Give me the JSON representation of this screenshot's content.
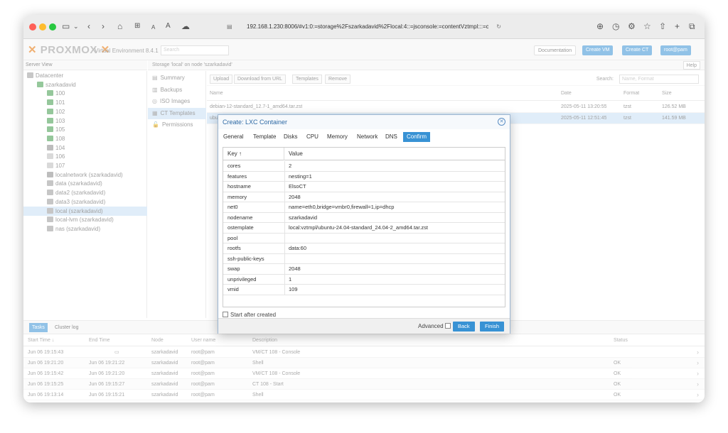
{
  "browser": {
    "url": "192.168.1.230:8006/#v1:0:=storage%2Fszarkadavid%2Flocal:4::=jsconsole:=contentVztmpl:::=con"
  },
  "header": {
    "logo": "PROXMOX",
    "version": "Virtual Environment 8.4.1",
    "search_placeholder": "Search",
    "buttons": {
      "documentation": "Documentation",
      "create_vm": "Create VM",
      "create_ct": "Create CT",
      "user": "root@pam"
    }
  },
  "server_view": "Server View",
  "tree": [
    {
      "label": "Datacenter",
      "icon": "datacenter-icon",
      "indent": 0
    },
    {
      "label": "szarkadavid",
      "icon": "node-icon",
      "indent": 1
    },
    {
      "label": "100",
      "icon": "container-icon",
      "indent": 2
    },
    {
      "label": "101",
      "icon": "container-icon",
      "indent": 2
    },
    {
      "label": "102",
      "icon": "container-icon",
      "indent": 2
    },
    {
      "label": "103",
      "icon": "container-icon",
      "indent": 2
    },
    {
      "label": "105",
      "icon": "container-icon",
      "indent": 2
    },
    {
      "label": "108",
      "icon": "container-icon",
      "indent": 2
    },
    {
      "label": "104",
      "icon": "vm-icon",
      "indent": 2
    },
    {
      "label": "106",
      "icon": "stopped-container-icon",
      "indent": 2
    },
    {
      "label": "107",
      "icon": "stopped-container-icon",
      "indent": 2
    },
    {
      "label": "localnetwork (szarkadavid)",
      "icon": "network-icon",
      "indent": 2
    },
    {
      "label": "data (szarkadavid)",
      "icon": "storage-icon",
      "indent": 2
    },
    {
      "label": "data2 (szarkadavid)",
      "icon": "storage-icon",
      "indent": 2
    },
    {
      "label": "data3 (szarkadavid)",
      "icon": "storage-icon",
      "indent": 2
    },
    {
      "label": "local (szarkadavid)",
      "icon": "storage-icon",
      "indent": 2
    },
    {
      "label": "local-lvm (szarkadavid)",
      "icon": "storage-icon",
      "indent": 2
    },
    {
      "label": "nas (szarkadavid)",
      "icon": "storage-icon",
      "indent": 2
    }
  ],
  "storage": {
    "title": "Storage 'local' on node 'szarkadavid'",
    "help": "Help",
    "nav": [
      {
        "label": "Summary",
        "icon": "summary-icon"
      },
      {
        "label": "Backups",
        "icon": "backups-icon"
      },
      {
        "label": "ISO Images",
        "icon": "iso-icon"
      },
      {
        "label": "CT Templates",
        "icon": "templates-icon"
      },
      {
        "label": "Permissions",
        "icon": "permissions-icon"
      }
    ],
    "toolbar": {
      "upload": "Upload",
      "download": "Download from URL",
      "templates": "Templates",
      "remove": "Remove",
      "search_label": "Search:",
      "search_placeholder": "Name, Format"
    },
    "columns": {
      "name": "Name",
      "date": "Date",
      "format": "Format",
      "size": "Size"
    },
    "rows": [
      {
        "name": "debian-12-standard_12.7-1_amd64.tar.zst",
        "date": "2025-05-11 13:20:55",
        "format": "tzst",
        "size": "126.52 MB"
      },
      {
        "name": "ubuntu-24.04-standard_24.04-2_amd64.tar.zst",
        "date": "2025-05-11 12:51:45",
        "format": "tzst",
        "size": "141.59 MB"
      }
    ]
  },
  "tasks": {
    "tabs": {
      "tasks": "Tasks",
      "cluster_log": "Cluster log"
    },
    "columns": {
      "start": "Start Time ↓",
      "end": "End Time",
      "node": "Node",
      "user": "User name",
      "desc": "Description",
      "status": "Status"
    },
    "rows": [
      {
        "start": "Jun 06 19:15:43",
        "end": "",
        "node": "szarkadavid",
        "user": "root@pam",
        "desc": "VM/CT 108 - Console",
        "status": ""
      },
      {
        "start": "Jun 06 19:21:20",
        "end": "Jun 06 19:21:22",
        "node": "szarkadavid",
        "user": "root@pam",
        "desc": "Shell",
        "status": "OK"
      },
      {
        "start": "Jun 06 19:15:42",
        "end": "Jun 06 19:21:20",
        "node": "szarkadavid",
        "user": "root@pam",
        "desc": "VM/CT 108 - Console",
        "status": "OK"
      },
      {
        "start": "Jun 06 19:15:25",
        "end": "Jun 06 19:15:27",
        "node": "szarkadavid",
        "user": "root@pam",
        "desc": "CT 108 - Start",
        "status": "OK"
      },
      {
        "start": "Jun 06 19:13:14",
        "end": "Jun 06 19:15:21",
        "node": "szarkadavid",
        "user": "root@pam",
        "desc": "Shell",
        "status": "OK"
      }
    ]
  },
  "dialog": {
    "title": "Create: LXC Container",
    "tabs": [
      "General",
      "Template",
      "Disks",
      "CPU",
      "Memory",
      "Network",
      "DNS",
      "Confirm"
    ],
    "active_tab": "Confirm",
    "key_header": "Key ↑",
    "value_header": "Value",
    "rows": [
      {
        "key": "cores",
        "value": "2"
      },
      {
        "key": "features",
        "value": "nesting=1"
      },
      {
        "key": "hostname",
        "value": "ElsoCT"
      },
      {
        "key": "memory",
        "value": "2048"
      },
      {
        "key": "net0",
        "value": "name=eth0,bridge=vmbr0,firewall=1,ip=dhcp"
      },
      {
        "key": "nodename",
        "value": "szarkadavid"
      },
      {
        "key": "ostemplate",
        "value": "local:vztmpl/ubuntu-24.04-standard_24.04-2_amd64.tar.zst"
      },
      {
        "key": "pool",
        "value": ""
      },
      {
        "key": "rootfs",
        "value": "data:60"
      },
      {
        "key": "ssh-public-keys",
        "value": ""
      },
      {
        "key": "swap",
        "value": "2048"
      },
      {
        "key": "unprivileged",
        "value": "1"
      },
      {
        "key": "vmid",
        "value": "109"
      }
    ],
    "start_after_created": "Start after created",
    "advanced": "Advanced",
    "back": "Back",
    "finish": "Finish"
  },
  "colors": {
    "accent": "#3892d4",
    "selection": "#c7dff5",
    "proxmox_orange": "#e57000"
  }
}
